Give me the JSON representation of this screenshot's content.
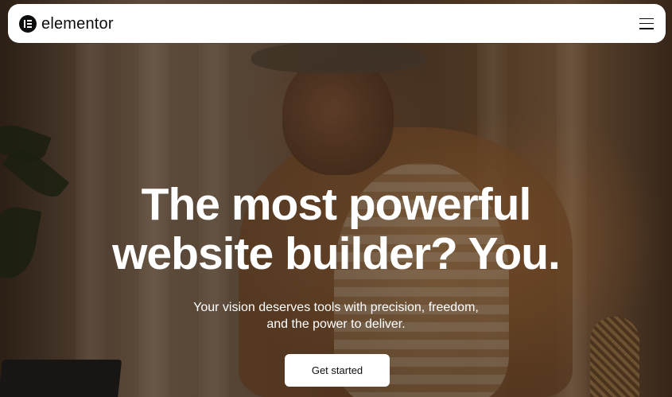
{
  "navbar": {
    "logo_icon": "elementor-logo-icon",
    "brand_name": "elementor",
    "menu_icon": "hamburger-menu-icon"
  },
  "hero": {
    "headline_line1": "The most powerful",
    "headline_line2": "website builder? You.",
    "subheadline_line1": "Your vision deserves tools with precision, freedom,",
    "subheadline_line2": "and the power to deliver.",
    "cta_label": "Get started",
    "background_image": "photo-parent-with-baby-at-laptop"
  },
  "colors": {
    "navbar_bg": "#ffffff",
    "text_dark": "#0c0d0e",
    "hero_text": "#ffffff",
    "button_bg": "#ffffff"
  }
}
